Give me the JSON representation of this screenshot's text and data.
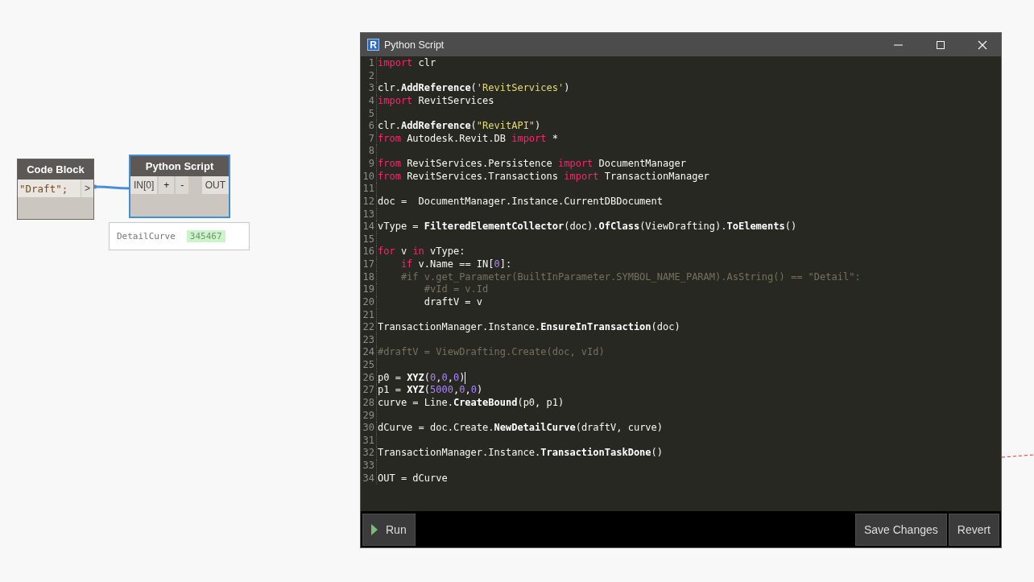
{
  "canvas": {
    "nodes": [
      {
        "kind": "code_block",
        "title": "Code Block",
        "code": "\"Draft\";",
        "output_port": ">",
        "selected": false
      },
      {
        "kind": "python_script",
        "title": "Python Script",
        "input_port": "IN[0]",
        "add_button": "+",
        "remove_button": "-",
        "output_port": "OUT",
        "selected": true,
        "preview": {
          "label": "DetailCurve",
          "value": "345467"
        }
      }
    ]
  },
  "editor": {
    "title": "Python Script",
    "icon_letter": "R",
    "lines": [
      {
        "number": "1",
        "spans": [
          {
            "kind": "keyword",
            "text": "import"
          },
          {
            "kind": "plain",
            "text": " clr"
          }
        ]
      },
      {
        "number": "2"
      },
      {
        "number": "3",
        "spans": [
          {
            "kind": "plain",
            "text": "clr."
          },
          {
            "kind": "function",
            "text": "AddReference"
          },
          {
            "kind": "plain",
            "text": "("
          },
          {
            "kind": "string",
            "text": "'RevitServices'"
          },
          {
            "kind": "plain",
            "text": ")"
          }
        ]
      },
      {
        "number": "4",
        "spans": [
          {
            "kind": "keyword",
            "text": "import"
          },
          {
            "kind": "plain",
            "text": " RevitServices"
          }
        ]
      },
      {
        "number": "5"
      },
      {
        "number": "6",
        "spans": [
          {
            "kind": "plain",
            "text": "clr."
          },
          {
            "kind": "function",
            "text": "AddReference"
          },
          {
            "kind": "plain",
            "text": "("
          },
          {
            "kind": "string",
            "text": "\"RevitAPI\""
          },
          {
            "kind": "plain",
            "text": ")"
          }
        ]
      },
      {
        "number": "7",
        "spans": [
          {
            "kind": "keyword",
            "text": "from"
          },
          {
            "kind": "plain",
            "text": " Autodesk.Revit.DB "
          },
          {
            "kind": "keyword",
            "text": "import"
          },
          {
            "kind": "plain",
            "text": " *"
          }
        ]
      },
      {
        "number": "8"
      },
      {
        "number": "9",
        "spans": [
          {
            "kind": "keyword",
            "text": "from"
          },
          {
            "kind": "plain",
            "text": " RevitServices.Persistence "
          },
          {
            "kind": "keyword",
            "text": "import"
          },
          {
            "kind": "plain",
            "text": " DocumentManager"
          }
        ]
      },
      {
        "number": "10",
        "spans": [
          {
            "kind": "keyword",
            "text": "from"
          },
          {
            "kind": "plain",
            "text": " RevitServices.Transactions "
          },
          {
            "kind": "keyword",
            "text": "import"
          },
          {
            "kind": "plain",
            "text": " TransactionManager"
          }
        ]
      },
      {
        "number": "11"
      },
      {
        "number": "12",
        "spans": [
          {
            "kind": "plain",
            "text": "doc =  DocumentManager.Instance.CurrentDBDocument"
          }
        ]
      },
      {
        "number": "13"
      },
      {
        "number": "14",
        "spans": [
          {
            "kind": "plain",
            "text": "vType = "
          },
          {
            "kind": "function",
            "text": "FilteredElementCollector"
          },
          {
            "kind": "plain",
            "text": "(doc)."
          },
          {
            "kind": "function",
            "text": "OfClass"
          },
          {
            "kind": "plain",
            "text": "(ViewDrafting)."
          },
          {
            "kind": "function",
            "text": "ToElements"
          },
          {
            "kind": "plain",
            "text": "()"
          }
        ]
      },
      {
        "number": "15"
      },
      {
        "number": "16",
        "spans": [
          {
            "kind": "keyword",
            "text": "for"
          },
          {
            "kind": "plain",
            "text": " v "
          },
          {
            "kind": "keyword",
            "text": "in"
          },
          {
            "kind": "plain",
            "text": " vType:"
          }
        ]
      },
      {
        "number": "17",
        "spans": [
          {
            "kind": "keyword",
            "text": "    if"
          },
          {
            "kind": "plain",
            "text": " v.Name == IN["
          },
          {
            "kind": "number",
            "text": "0"
          },
          {
            "kind": "plain",
            "text": "]:"
          }
        ]
      },
      {
        "number": "18",
        "spans": [
          {
            "kind": "comment",
            "text": "    #if v.get_Parameter(BuiltInParameter.SYMBOL_NAME_PARAM).AsString() == \"Detail\":"
          }
        ]
      },
      {
        "number": "19",
        "spans": [
          {
            "kind": "comment",
            "text": "        #vId = v.Id"
          }
        ]
      },
      {
        "number": "20",
        "spans": [
          {
            "kind": "plain",
            "text": "        draftV = v"
          }
        ]
      },
      {
        "number": "21"
      },
      {
        "number": "22",
        "spans": [
          {
            "kind": "plain",
            "text": "TransactionManager.Instance."
          },
          {
            "kind": "function",
            "text": "EnsureInTransaction"
          },
          {
            "kind": "plain",
            "text": "(doc)"
          }
        ]
      },
      {
        "number": "23"
      },
      {
        "number": "24",
        "spans": [
          {
            "kind": "comment",
            "text": "#draftV = ViewDrafting.Create(doc, vId)"
          }
        ]
      },
      {
        "number": "25"
      },
      {
        "number": "26",
        "cursor": true,
        "spans": [
          {
            "kind": "plain",
            "text": "p0 = "
          },
          {
            "kind": "function",
            "text": "XYZ"
          },
          {
            "kind": "plain",
            "text": "("
          },
          {
            "kind": "number",
            "text": "0"
          },
          {
            "kind": "plain",
            "text": ","
          },
          {
            "kind": "number",
            "text": "0"
          },
          {
            "kind": "plain",
            "text": ","
          },
          {
            "kind": "number",
            "text": "0"
          },
          {
            "kind": "plain",
            "text": ")"
          }
        ]
      },
      {
        "number": "27",
        "spans": [
          {
            "kind": "plain",
            "text": "p1 = "
          },
          {
            "kind": "function",
            "text": "XYZ"
          },
          {
            "kind": "plain",
            "text": "("
          },
          {
            "kind": "number",
            "text": "5000"
          },
          {
            "kind": "plain",
            "text": ","
          },
          {
            "kind": "number",
            "text": "0"
          },
          {
            "kind": "plain",
            "text": ","
          },
          {
            "kind": "number",
            "text": "0"
          },
          {
            "kind": "plain",
            "text": ")"
          }
        ]
      },
      {
        "number": "28",
        "spans": [
          {
            "kind": "plain",
            "text": "curve = Line."
          },
          {
            "kind": "function",
            "text": "CreateBound"
          },
          {
            "kind": "plain",
            "text": "(p0, p1)"
          }
        ]
      },
      {
        "number": "29"
      },
      {
        "number": "30",
        "spans": [
          {
            "kind": "plain",
            "text": "dCurve = doc.Create."
          },
          {
            "kind": "function",
            "text": "NewDetailCurve"
          },
          {
            "kind": "plain",
            "text": "(draftV, curve)"
          }
        ]
      },
      {
        "number": "31"
      },
      {
        "number": "32",
        "spans": [
          {
            "kind": "plain",
            "text": "TransactionManager.Instance."
          },
          {
            "kind": "function",
            "text": "TransactionTaskDone"
          },
          {
            "kind": "plain",
            "text": "()"
          }
        ]
      },
      {
        "number": "33"
      },
      {
        "number": "34",
        "spans": [
          {
            "kind": "plain",
            "text": "OUT = dCurve"
          }
        ]
      }
    ],
    "run_button": "Run",
    "save_button": "Save Changes",
    "revert_button": "Revert"
  }
}
